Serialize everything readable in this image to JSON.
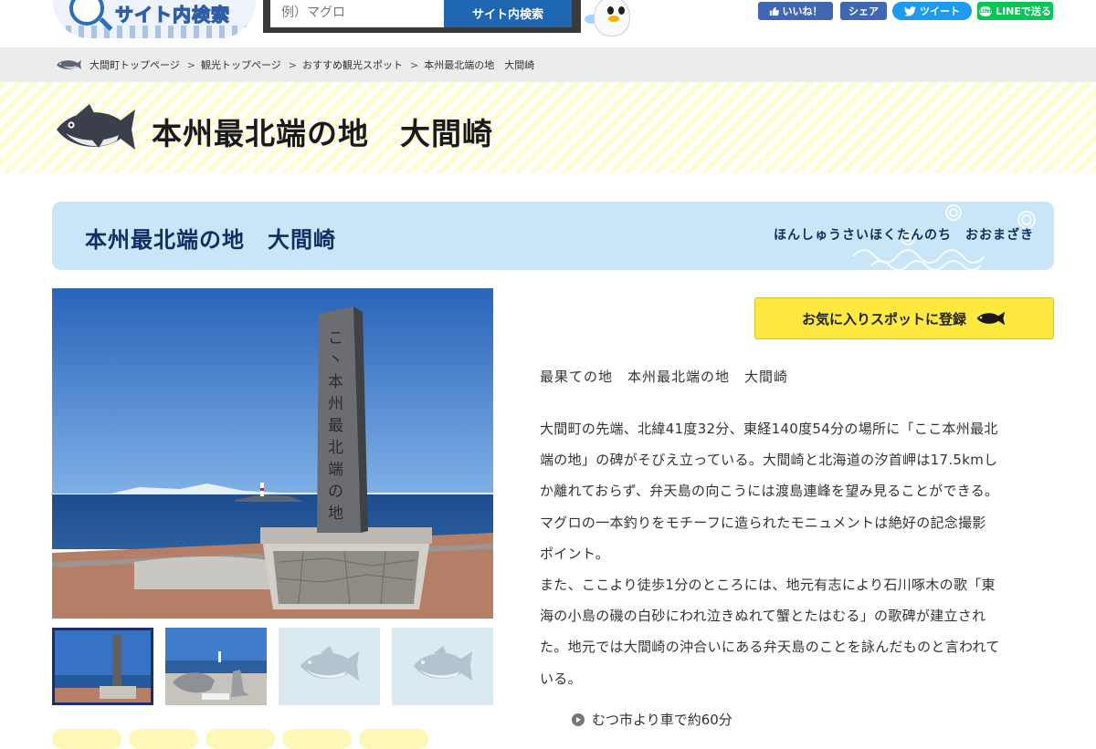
{
  "header": {
    "logo_text": "サイト内検索",
    "search": {
      "placeholder": "例）マグロ",
      "button_label": "サイト内検索"
    },
    "social": {
      "like_label": "いいね！",
      "share_label": "シェア",
      "tweet_label": "ツイート",
      "line_label": "LINEで送る",
      "line_icon_text": "LINE"
    }
  },
  "breadcrumb": {
    "items": [
      "大間町トップページ",
      "観光トップページ",
      "おすすめ観光スポット",
      "本州最北端の地　大間崎"
    ],
    "separator": ">"
  },
  "page": {
    "title": "本州最北端の地　大間崎"
  },
  "spot": {
    "name": "本州最北端の地　大間崎",
    "reading": "ほんしゅうさいほくたんのち　おおまざき",
    "favorite_button_label": "お気に入りスポットに登録",
    "catchphrase": "最果ての地　本州最北端の地　大間崎",
    "description_lines": [
      "大間町の先端、北緯41度32分、東経140度54分の場所に「ここ本州最北",
      "端の地」の碑がそびえ立っている。大間崎と北海道の汐首岬は17.5kmし",
      "か離れておらず、弁天島の向こうには渡島連峰を望み見ることができる。",
      "マグロの一本釣りをモチーフに造られたモニュメントは絶好の記念撮影",
      "ポイント。",
      "また、ここより徒歩1分のところには、地元有志により石川啄木の歌「東",
      "海の小島の磯の白砂にわれ泣きぬれて蟹とたはむる」の歌碑が建立され",
      "た。地元では大間崎の沖合いにある弁天島のことを詠んだものと言われて",
      "いる。"
    ],
    "access": "むつ市より車で約60分",
    "monument_inscription": "ここ本州最北端の地"
  },
  "colors": {
    "brand_blue": "#1f66b3",
    "spot_header_bg": "#c9e6f8",
    "spot_text": "#0f2f63",
    "favorite_yellow": "#ffe941",
    "facebook": "#4267b2",
    "twitter": "#1d9bf0",
    "line": "#06c755"
  },
  "icons": [
    "magnifier-icon",
    "like-icon",
    "twitter-bird-icon",
    "line-icon",
    "tuna-icon",
    "access-marker-icon"
  ]
}
